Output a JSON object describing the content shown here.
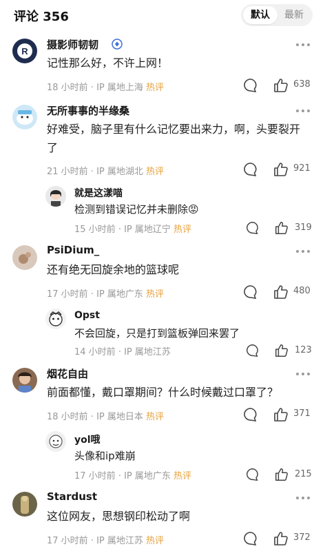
{
  "header": {
    "title": "评论 356",
    "sort_default": "默认",
    "sort_latest": "最新"
  },
  "comments": [
    {
      "name": "摄影师韧韧",
      "text": "记性那么好，不许上网！",
      "time": "18 小时前",
      "ip": "IP 属地上海",
      "hot": "热评",
      "likes": "638"
    },
    {
      "name": "无所事事的半缘桑",
      "text": "好难受，脑子里有什么记忆要出来力，啊，头要裂开了",
      "time": "21 小时前",
      "ip": "IP 属地湖北",
      "hot": "热评",
      "likes": "921"
    },
    {
      "name": "就是这漾喵",
      "text": "检测到错误记忆并未删除",
      "emoji": "😡",
      "time": "15 小时前",
      "ip": "IP 属地辽宁",
      "hot": "热评",
      "likes": "319"
    },
    {
      "name": "PsiDium_",
      "text": "还有绝无回旋余地的篮球呢",
      "time": "17 小时前",
      "ip": "IP 属地广东",
      "hot": "热评",
      "likes": "480"
    },
    {
      "name": "Opst",
      "text": "不会回旋，只是打到篮板弹回来罢了",
      "time": "14 小时前",
      "ip": "IP 属地江苏",
      "likes": "123"
    },
    {
      "name": "烟花自由",
      "text": "前面都懂，戴口罩期间？什么时候戴过口罩了？",
      "time": "18 小时前",
      "ip": "IP 属地日本",
      "hot": "热评",
      "likes": "371"
    },
    {
      "name": "yol哦",
      "text": "头像和ip难崩",
      "time": "17 小时前",
      "ip": "IP 属地广东",
      "hot": "热评",
      "likes": "215"
    },
    {
      "name": "Stardust",
      "text": "这位网友，思想钢印松动了啊",
      "time": "17 小时前",
      "ip": "IP 属地江苏",
      "hot": "热评",
      "likes": "372"
    }
  ],
  "icons": {
    "verified": "verified-badge-icon",
    "more": "more-dots-icon",
    "reply": "comment-bubble-icon",
    "like": "thumb-up-icon"
  },
  "colors": {
    "hot": "#e6a23c",
    "meta": "#999999",
    "verified": "#3b6fd8"
  }
}
